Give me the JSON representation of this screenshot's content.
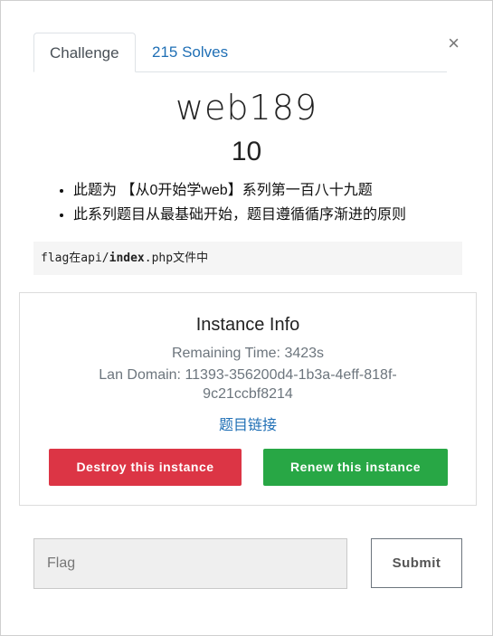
{
  "tabs": {
    "challenge": "Challenge",
    "solves": "215 Solves"
  },
  "close_icon": "×",
  "challenge": {
    "name": "web189",
    "value": "10",
    "description": [
      "此题为 【从0开始学web】系列第一百八十九题",
      "此系列题目从最基础开始，题目遵循循序渐进的原则"
    ],
    "hint": {
      "prefix": "flag在api/",
      "bold": "index",
      "suffix": ".php文件中"
    }
  },
  "instance": {
    "title": "Instance Info",
    "remaining": "Remaining Time: 3423s",
    "domain_line1": "Lan Domain: 11393-356200d4-1b3a-4eff-818f-",
    "domain_line2": "9c21ccbf8214",
    "link": "题目链接",
    "destroy": "Destroy this instance",
    "renew": "Renew this instance"
  },
  "submission": {
    "placeholder": "Flag",
    "submit": "Submit"
  },
  "colors": {
    "destroy": "#dc3545",
    "renew": "#28a745",
    "link": "#1f6fb5"
  }
}
